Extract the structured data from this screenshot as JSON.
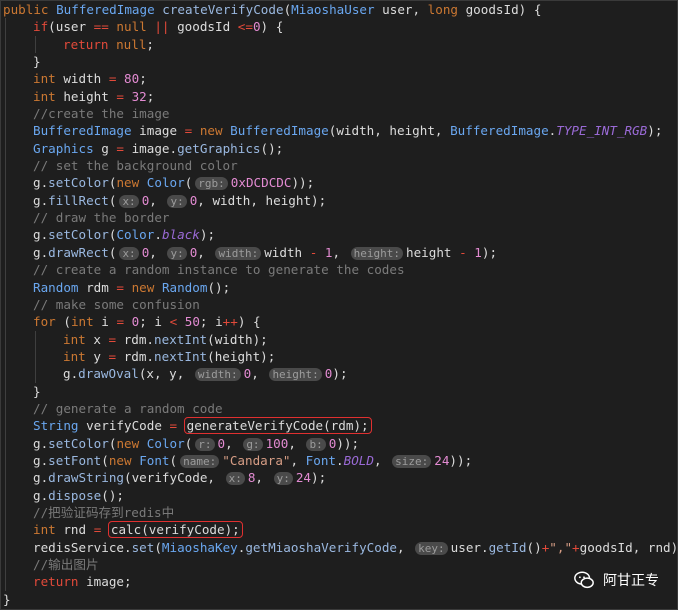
{
  "code": {
    "lines": [
      {
        "indent": 0,
        "tokens": [
          [
            "kw",
            "public "
          ],
          [
            "ty",
            "BufferedImage "
          ],
          [
            "fn",
            "createVerifyCode"
          ],
          [
            "",
            "("
          ],
          [
            "ty",
            "MiaoshaUser "
          ],
          [
            "",
            "user, "
          ],
          [
            "kw",
            "long "
          ],
          [
            "",
            "goodsId) {"
          ]
        ]
      },
      {
        "indent": 1,
        "tokens": [
          [
            "op",
            "if"
          ],
          [
            "",
            "(user "
          ],
          [
            "op",
            "=="
          ],
          [
            "kw",
            " null "
          ],
          [
            "op",
            "||"
          ],
          [
            "",
            " goodsId "
          ],
          [
            "op",
            "<="
          ],
          [
            "num",
            "0"
          ],
          [
            "",
            ") {"
          ]
        ]
      },
      {
        "indent": 2,
        "tokens": [
          [
            "op",
            "return "
          ],
          [
            "kw",
            "null"
          ],
          [
            "",
            ";"
          ]
        ]
      },
      {
        "indent": 1,
        "tokens": [
          [
            "",
            "}"
          ]
        ]
      },
      {
        "indent": 1,
        "tokens": [
          [
            "kw",
            "int "
          ],
          [
            "",
            "width "
          ],
          [
            "op",
            "= "
          ],
          [
            "num",
            "80"
          ],
          [
            "",
            ";"
          ]
        ]
      },
      {
        "indent": 1,
        "tokens": [
          [
            "kw",
            "int "
          ],
          [
            "",
            "height "
          ],
          [
            "op",
            "= "
          ],
          [
            "num",
            "32"
          ],
          [
            "",
            ";"
          ]
        ]
      },
      {
        "indent": 1,
        "tokens": [
          [
            "cm",
            "//create the image"
          ]
        ]
      },
      {
        "indent": 1,
        "tokens": [
          [
            "ty",
            "BufferedImage "
          ],
          [
            "",
            "image "
          ],
          [
            "op",
            "= "
          ],
          [
            "kw",
            "new "
          ],
          [
            "ty",
            "BufferedImage"
          ],
          [
            "",
            "(width, height, "
          ],
          [
            "ty",
            "BufferedImage"
          ],
          [
            "",
            "."
          ],
          [
            "cn",
            "TYPE_INT_RGB"
          ],
          [
            "",
            ");"
          ]
        ]
      },
      {
        "indent": 1,
        "tokens": [
          [
            "ty",
            "Graphics "
          ],
          [
            "",
            "g "
          ],
          [
            "op",
            "= "
          ],
          [
            "",
            "image."
          ],
          [
            "fn",
            "getGraphics"
          ],
          [
            "",
            "();"
          ]
        ]
      },
      {
        "indent": 1,
        "tokens": [
          [
            "cm",
            "// set the background color"
          ]
        ]
      },
      {
        "indent": 1,
        "tokens": [
          [
            "",
            "g."
          ],
          [
            "fn",
            "setColor"
          ],
          [
            "",
            "("
          ],
          [
            "kw",
            "new "
          ],
          [
            "ty",
            "Color"
          ],
          [
            "",
            "("
          ],
          [
            "hint",
            "rgb:"
          ],
          [
            "num",
            "0xDCDCDC"
          ],
          [
            "",
            "));"
          ]
        ]
      },
      {
        "indent": 1,
        "tokens": [
          [
            "",
            "g."
          ],
          [
            "fn",
            "fillRect"
          ],
          [
            "",
            "("
          ],
          [
            "hint",
            "x:"
          ],
          [
            "num",
            "0"
          ],
          [
            "",
            ", "
          ],
          [
            "hint",
            "y:"
          ],
          [
            "num",
            "0"
          ],
          [
            "",
            ", width, height);"
          ]
        ]
      },
      {
        "indent": 1,
        "tokens": [
          [
            "cm",
            "// draw the border"
          ]
        ]
      },
      {
        "indent": 1,
        "tokens": [
          [
            "",
            "g."
          ],
          [
            "fn",
            "setColor"
          ],
          [
            "",
            "("
          ],
          [
            "ty",
            "Color"
          ],
          [
            "",
            "."
          ],
          [
            "cn",
            "black"
          ],
          [
            "",
            ");"
          ]
        ]
      },
      {
        "indent": 1,
        "tokens": [
          [
            "",
            "g."
          ],
          [
            "fn",
            "drawRect"
          ],
          [
            "",
            "("
          ],
          [
            "hint",
            "x:"
          ],
          [
            "num",
            "0"
          ],
          [
            "",
            ", "
          ],
          [
            "hint",
            "y:"
          ],
          [
            "num",
            "0"
          ],
          [
            "",
            ", "
          ],
          [
            "hint",
            "width:"
          ],
          [
            "",
            "width "
          ],
          [
            "op",
            "- "
          ],
          [
            "num",
            "1"
          ],
          [
            "",
            ", "
          ],
          [
            "hint",
            "height:"
          ],
          [
            "",
            "height "
          ],
          [
            "op",
            "- "
          ],
          [
            "num",
            "1"
          ],
          [
            "",
            ");"
          ]
        ]
      },
      {
        "indent": 1,
        "tokens": [
          [
            "cm",
            "// create a random instance to generate the codes"
          ]
        ]
      },
      {
        "indent": 1,
        "tokens": [
          [
            "ty",
            "Random "
          ],
          [
            "",
            "rdm "
          ],
          [
            "op",
            "= "
          ],
          [
            "kw",
            "new "
          ],
          [
            "ty",
            "Random"
          ],
          [
            "",
            "();"
          ]
        ]
      },
      {
        "indent": 1,
        "tokens": [
          [
            "cm",
            "// make some confusion"
          ]
        ]
      },
      {
        "indent": 1,
        "tokens": [
          [
            "kw",
            "for "
          ],
          [
            "",
            "("
          ],
          [
            "kw",
            "int "
          ],
          [
            "",
            "i "
          ],
          [
            "op",
            "= "
          ],
          [
            "num",
            "0"
          ],
          [
            "",
            "; i "
          ],
          [
            "op",
            "< "
          ],
          [
            "num",
            "50"
          ],
          [
            "",
            "; i"
          ],
          [
            "op",
            "++"
          ],
          [
            "",
            ") {"
          ]
        ]
      },
      {
        "indent": 2,
        "tokens": [
          [
            "kw",
            "int "
          ],
          [
            "",
            "x "
          ],
          [
            "op",
            "= "
          ],
          [
            "",
            "rdm."
          ],
          [
            "fn",
            "nextInt"
          ],
          [
            "",
            "(width);"
          ]
        ]
      },
      {
        "indent": 2,
        "tokens": [
          [
            "kw",
            "int "
          ],
          [
            "",
            "y "
          ],
          [
            "op",
            "= "
          ],
          [
            "",
            "rdm."
          ],
          [
            "fn",
            "nextInt"
          ],
          [
            "",
            "(height);"
          ]
        ]
      },
      {
        "indent": 2,
        "tokens": [
          [
            "",
            "g."
          ],
          [
            "fn",
            "drawOval"
          ],
          [
            "",
            "(x, y, "
          ],
          [
            "hint",
            "width:"
          ],
          [
            "num",
            "0"
          ],
          [
            "",
            ", "
          ],
          [
            "hint",
            "height:"
          ],
          [
            "num",
            "0"
          ],
          [
            "",
            ");"
          ]
        ]
      },
      {
        "indent": 1,
        "tokens": [
          [
            "",
            "}"
          ]
        ]
      },
      {
        "indent": 1,
        "tokens": [
          [
            "cm",
            "// generate a random code"
          ]
        ]
      },
      {
        "indent": 1,
        "tokens": [
          [
            "ty",
            "String "
          ],
          [
            "",
            "verifyCode "
          ],
          [
            "op",
            "= "
          ],
          [
            "box",
            "generateVerifyCode(rdm);"
          ]
        ]
      },
      {
        "indent": 1,
        "tokens": [
          [
            "",
            "g."
          ],
          [
            "fn",
            "setColor"
          ],
          [
            "",
            "("
          ],
          [
            "kw",
            "new "
          ],
          [
            "ty",
            "Color"
          ],
          [
            "",
            "("
          ],
          [
            "hint",
            "r:"
          ],
          [
            "num",
            "0"
          ],
          [
            "",
            ", "
          ],
          [
            "hint",
            "g:"
          ],
          [
            "num",
            "100"
          ],
          [
            "",
            ", "
          ],
          [
            "hint",
            "b:"
          ],
          [
            "num",
            "0"
          ],
          [
            "",
            "));"
          ]
        ]
      },
      {
        "indent": 1,
        "tokens": [
          [
            "",
            "g."
          ],
          [
            "fn",
            "setFont"
          ],
          [
            "",
            "("
          ],
          [
            "kw",
            "new "
          ],
          [
            "ty",
            "Font"
          ],
          [
            "",
            "("
          ],
          [
            "hint",
            "name:"
          ],
          [
            "str",
            "\"Candara\""
          ],
          [
            "",
            ", "
          ],
          [
            "ty",
            "Font"
          ],
          [
            "",
            "."
          ],
          [
            "cn",
            "BOLD"
          ],
          [
            "",
            ", "
          ],
          [
            "hint",
            "size:"
          ],
          [
            "num",
            "24"
          ],
          [
            "",
            "));"
          ]
        ]
      },
      {
        "indent": 1,
        "tokens": [
          [
            "",
            "g."
          ],
          [
            "fn",
            "drawString"
          ],
          [
            "",
            "(verifyCode, "
          ],
          [
            "hint",
            "x:"
          ],
          [
            "num",
            "8"
          ],
          [
            "",
            ", "
          ],
          [
            "hint",
            "y:"
          ],
          [
            "num",
            "24"
          ],
          [
            "",
            ");"
          ]
        ]
      },
      {
        "indent": 1,
        "tokens": [
          [
            "",
            "g."
          ],
          [
            "fn",
            "dispose"
          ],
          [
            "",
            "();"
          ]
        ]
      },
      {
        "indent": 1,
        "tokens": [
          [
            "cm",
            "//把验证码存到redis中"
          ]
        ]
      },
      {
        "indent": 1,
        "tokens": [
          [
            "kw",
            "int "
          ],
          [
            "",
            "rnd "
          ],
          [
            "op",
            "= "
          ],
          [
            "box",
            "calc(verifyCode);"
          ]
        ]
      },
      {
        "indent": 1,
        "tokens": [
          [
            "",
            "redisService."
          ],
          [
            "fn",
            "set"
          ],
          [
            "",
            "("
          ],
          [
            "ty",
            "MiaoshaKey"
          ],
          [
            "",
            "."
          ],
          [
            "fn",
            "getMiaoshaVerifyCode"
          ],
          [
            "",
            ", "
          ],
          [
            "hint",
            "key:"
          ],
          [
            "",
            "user."
          ],
          [
            "fn",
            "getId"
          ],
          [
            "",
            "()"
          ],
          [
            "op",
            "+"
          ],
          [
            "str",
            "\",\""
          ],
          [
            "op",
            "+"
          ],
          [
            "",
            "goodsId, rnd);"
          ]
        ]
      },
      {
        "indent": 1,
        "tokens": [
          [
            "cm",
            "//输出图片"
          ]
        ]
      },
      {
        "indent": 1,
        "tokens": [
          [
            "op",
            "return "
          ],
          [
            "",
            "image;"
          ]
        ]
      },
      {
        "indent": 0,
        "tokens": [
          [
            "",
            "}"
          ]
        ]
      }
    ]
  },
  "watermark": {
    "label": "阿甘正专",
    "icon": "wechat-icon"
  },
  "colors": {
    "background": "#1e1e1e",
    "highlight_box": "#e03030"
  }
}
